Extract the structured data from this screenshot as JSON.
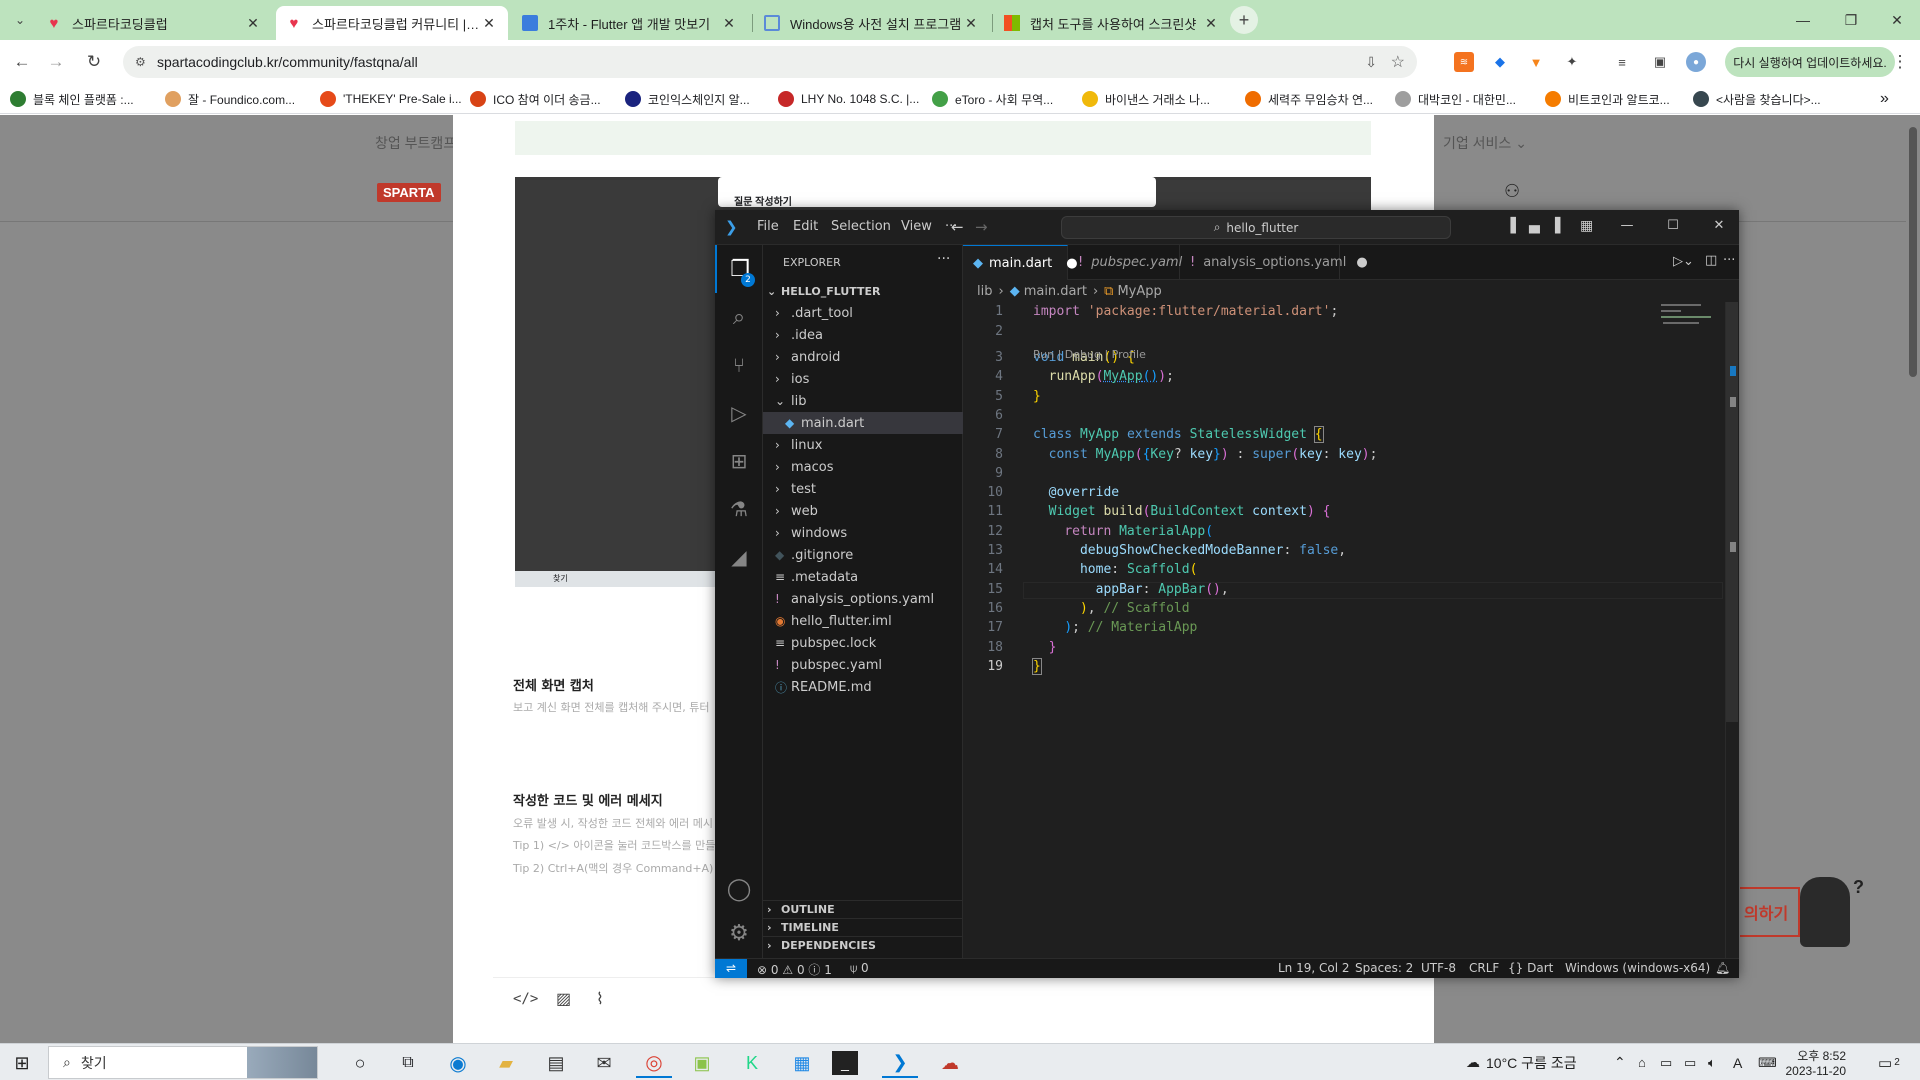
{
  "browser": {
    "tabs": [
      {
        "title": "스파르타코딩클럽",
        "active": false,
        "icon": "heart-icon",
        "color": "#e8344e"
      },
      {
        "title": "스파르타코딩클럽 커뮤니티 | 스파르타코딩클럽",
        "active": true,
        "icon": "heart-icon",
        "color": "#e8344e"
      },
      {
        "title": "1주차 - Flutter 앱 개발 맛보기",
        "active": false,
        "icon": "doc-icon",
        "color": "#3b7ddd"
      },
      {
        "title": "Windows용 사전 설치 프로그램",
        "active": false,
        "icon": "window-icon",
        "color": "#5b8ad8"
      },
      {
        "title": "캡처 도구를 사용하여 스크린샷",
        "active": false,
        "icon": "ms-icon",
        "color": "#f25022"
      }
    ],
    "url": "spartacodingclub.kr/community/fastqna/all",
    "relaunch_label": "다시 실행하여 업데이트하세요.",
    "bookmarks": [
      {
        "label": "블록 체인 플랫폼 :...",
        "color": "#2e7d32"
      },
      {
        "label": "잘 - Foundico.com...",
        "color": "#e0a060"
      },
      {
        "label": "'THEKEY' Pre-Sale i...",
        "color": "#e64a19"
      },
      {
        "label": "ICO 참여 이더 송금...",
        "color": "#d84315"
      },
      {
        "label": "코인익스체인지 알...",
        "color": "#1a237e"
      },
      {
        "label": "LHY No. 1048 S.C. |...",
        "color": "#c62828"
      },
      {
        "label": "eToro - 사회 무역...",
        "color": "#43a047"
      },
      {
        "label": "바이낸스 거래소 나...",
        "color": "#f0b90b"
      },
      {
        "label": "세력주 무임승차 연...",
        "color": "#ef6c00"
      },
      {
        "label": "대박코인 - 대한민...",
        "color": "#9e9e9e"
      },
      {
        "label": "비트코인과 알트코...",
        "color": "#f57c00"
      },
      {
        "label": "<사람을 찾습니다>...",
        "color": "#37474f"
      }
    ]
  },
  "page": {
    "nav_left": "창업 부트캠프",
    "nav_right": "기업 서비스",
    "brand": "SPARTA",
    "section1_title": "전체 화면 캡처",
    "section1_hint": "보고 계신 화면 전체를 캡처해 주시면, 튜터",
    "section2_title": "작성한 코드 및 에러 메세지",
    "section2_hint": "오류 발생 시, 작성한 코드 전체와 에러 메시",
    "tip1": "Tip 1) </> 아이콘을 눌러 코드박스를 만들어",
    "tip2": "Tip 2) Ctrl+A(맥의 경우 Command+A) 를",
    "ask_button": "의하기",
    "inner_dialog_title": "질문 작성하기",
    "inner_search": "찾기"
  },
  "vscode": {
    "menu": [
      "File",
      "Edit",
      "Selection",
      "View",
      "···"
    ],
    "command_center": "hello_flutter",
    "explorer_title": "EXPLORER",
    "root": "HELLO_FLUTTER",
    "tree": [
      {
        "label": ".dart_tool",
        "type": "folder",
        "indent": 1
      },
      {
        "label": ".idea",
        "type": "folder",
        "indent": 1
      },
      {
        "label": "android",
        "type": "folder",
        "indent": 1
      },
      {
        "label": "ios",
        "type": "folder",
        "indent": 1
      },
      {
        "label": "lib",
        "type": "folder-open",
        "indent": 1
      },
      {
        "label": "main.dart",
        "type": "dart",
        "indent": 2,
        "selected": true
      },
      {
        "label": "linux",
        "type": "folder",
        "indent": 1
      },
      {
        "label": "macos",
        "type": "folder",
        "indent": 1
      },
      {
        "label": "test",
        "type": "folder",
        "indent": 1
      },
      {
        "label": "web",
        "type": "folder",
        "indent": 1
      },
      {
        "label": "windows",
        "type": "folder",
        "indent": 1
      },
      {
        "label": ".gitignore",
        "type": "git",
        "indent": 1
      },
      {
        "label": ".metadata",
        "type": "lines",
        "indent": 1
      },
      {
        "label": "analysis_options.yaml",
        "type": "yaml",
        "indent": 1
      },
      {
        "label": "hello_flutter.iml",
        "type": "rss",
        "indent": 1
      },
      {
        "label": "pubspec.lock",
        "type": "lines",
        "indent": 1
      },
      {
        "label": "pubspec.yaml",
        "type": "yaml",
        "indent": 1
      },
      {
        "label": "README.md",
        "type": "info",
        "indent": 1
      }
    ],
    "sections": [
      "OUTLINE",
      "TIMELINE",
      "DEPENDENCIES"
    ],
    "tabs": [
      {
        "label": "main.dart",
        "active": true,
        "italic": false,
        "dot": true
      },
      {
        "label": "pubspec.yaml",
        "active": false,
        "italic": true,
        "dot": false
      },
      {
        "label": "analysis_options.yaml",
        "active": false,
        "italic": false,
        "dot": true
      }
    ],
    "breadcrumb": [
      "lib",
      "main.dart",
      "MyApp"
    ],
    "codelens": "Run | Debug | Profile",
    "code": [
      {
        "n": "1",
        "html": "<span class=\"ctl\">import</span> <span class=\"str\">'package:flutter/material.dart'</span>;"
      },
      {
        "n": "2",
        "html": ""
      },
      {
        "n": "3",
        "html": "<span class=\"kw\">void</span> <span class=\"fn\">main</span><span class=\"pun\">()</span> <span class=\"pun\">{</span>"
      },
      {
        "n": "4",
        "html": "  <span class=\"fn\">runApp</span><span style=\"color:#da70d6\">(</span><span class=\"cls\" style=\"text-decoration:underline dotted #3794ff\">MyApp</span><span style=\"color:#179fff;text-decoration:underline dotted #3794ff\">()</span><span style=\"color:#da70d6\">)</span>;"
      },
      {
        "n": "5",
        "html": "<span class=\"pun\">}</span>"
      },
      {
        "n": "6",
        "html": ""
      },
      {
        "n": "7",
        "html": "<span class=\"kw\">class</span> <span class=\"cls\">MyApp</span> <span class=\"kw\">extends</span> <span class=\"cls\">StatelessWidget</span> <span class=\"pun\" style=\"outline:1px solid #888\">{</span>"
      },
      {
        "n": "8",
        "html": "  <span class=\"kw\">const</span> <span class=\"cls\">MyApp</span><span style=\"color:#da70d6\">(</span><span style=\"color:#179fff\">{</span><span class=\"cls\">Key</span>? <span class=\"var\">key</span><span style=\"color:#179fff\">}</span><span style=\"color:#da70d6\">)</span> : <span class=\"kw\">super</span><span style=\"color:#da70d6\">(</span><span class=\"var\">key</span>: <span class=\"var\">key</span><span style=\"color:#da70d6\">)</span>;"
      },
      {
        "n": "9",
        "html": ""
      },
      {
        "n": "10",
        "html": "  <span class=\"var\">@override</span>"
      },
      {
        "n": "11",
        "html": "  <span class=\"cls\">Widget</span> <span class=\"fn\">build</span><span style=\"color:#da70d6\">(</span><span class=\"cls\">BuildContext</span> <span class=\"var\">context</span><span style=\"color:#da70d6\">)</span> <span style=\"color:#da70d6\">{</span>"
      },
      {
        "n": "12",
        "html": "    <span class=\"ctl\">return</span> <span class=\"cls\">MaterialApp</span><span style=\"color:#179fff\">(</span>"
      },
      {
        "n": "13",
        "html": "      <span class=\"var\">debugShowCheckedModeBanner</span>: <span class=\"kw\">false</span>,"
      },
      {
        "n": "14",
        "html": "      <span class=\"var\">home</span>: <span class=\"cls\">Scaffold</span><span class=\"pun\">(</span>"
      },
      {
        "n": "15",
        "html": "        <span class=\"var\">appBar</span>: <span class=\"cls\">AppBar</span><span style=\"color:#da70d6\">()</span>,"
      },
      {
        "n": "16",
        "html": "      <span class=\"pun\">)</span>, <span class=\"cm\">// Scaffold</span>"
      },
      {
        "n": "17",
        "html": "    <span style=\"color:#179fff\">)</span>; <span class=\"cm\">// MaterialApp</span>"
      },
      {
        "n": "18",
        "html": "  <span style=\"color:#da70d6\">}</span>"
      },
      {
        "n": "19",
        "html": "<span class=\"pun\" style=\"outline:1px solid #888\">}</span>"
      }
    ],
    "status": {
      "errors": "0",
      "warnings": "0",
      "infos": "1",
      "ports": "0",
      "position": "Ln 19, Col 2",
      "spaces": "Spaces: 2",
      "encoding": "UTF-8",
      "eol": "CRLF",
      "language": "Dart",
      "device": "Windows (windows-x64)"
    }
  },
  "taskbar": {
    "search": "찾기",
    "weather": "10°C  구름 조금",
    "time": "오후 8:52",
    "date": "2023-11-20",
    "notifications": "2",
    "ime": "A"
  }
}
